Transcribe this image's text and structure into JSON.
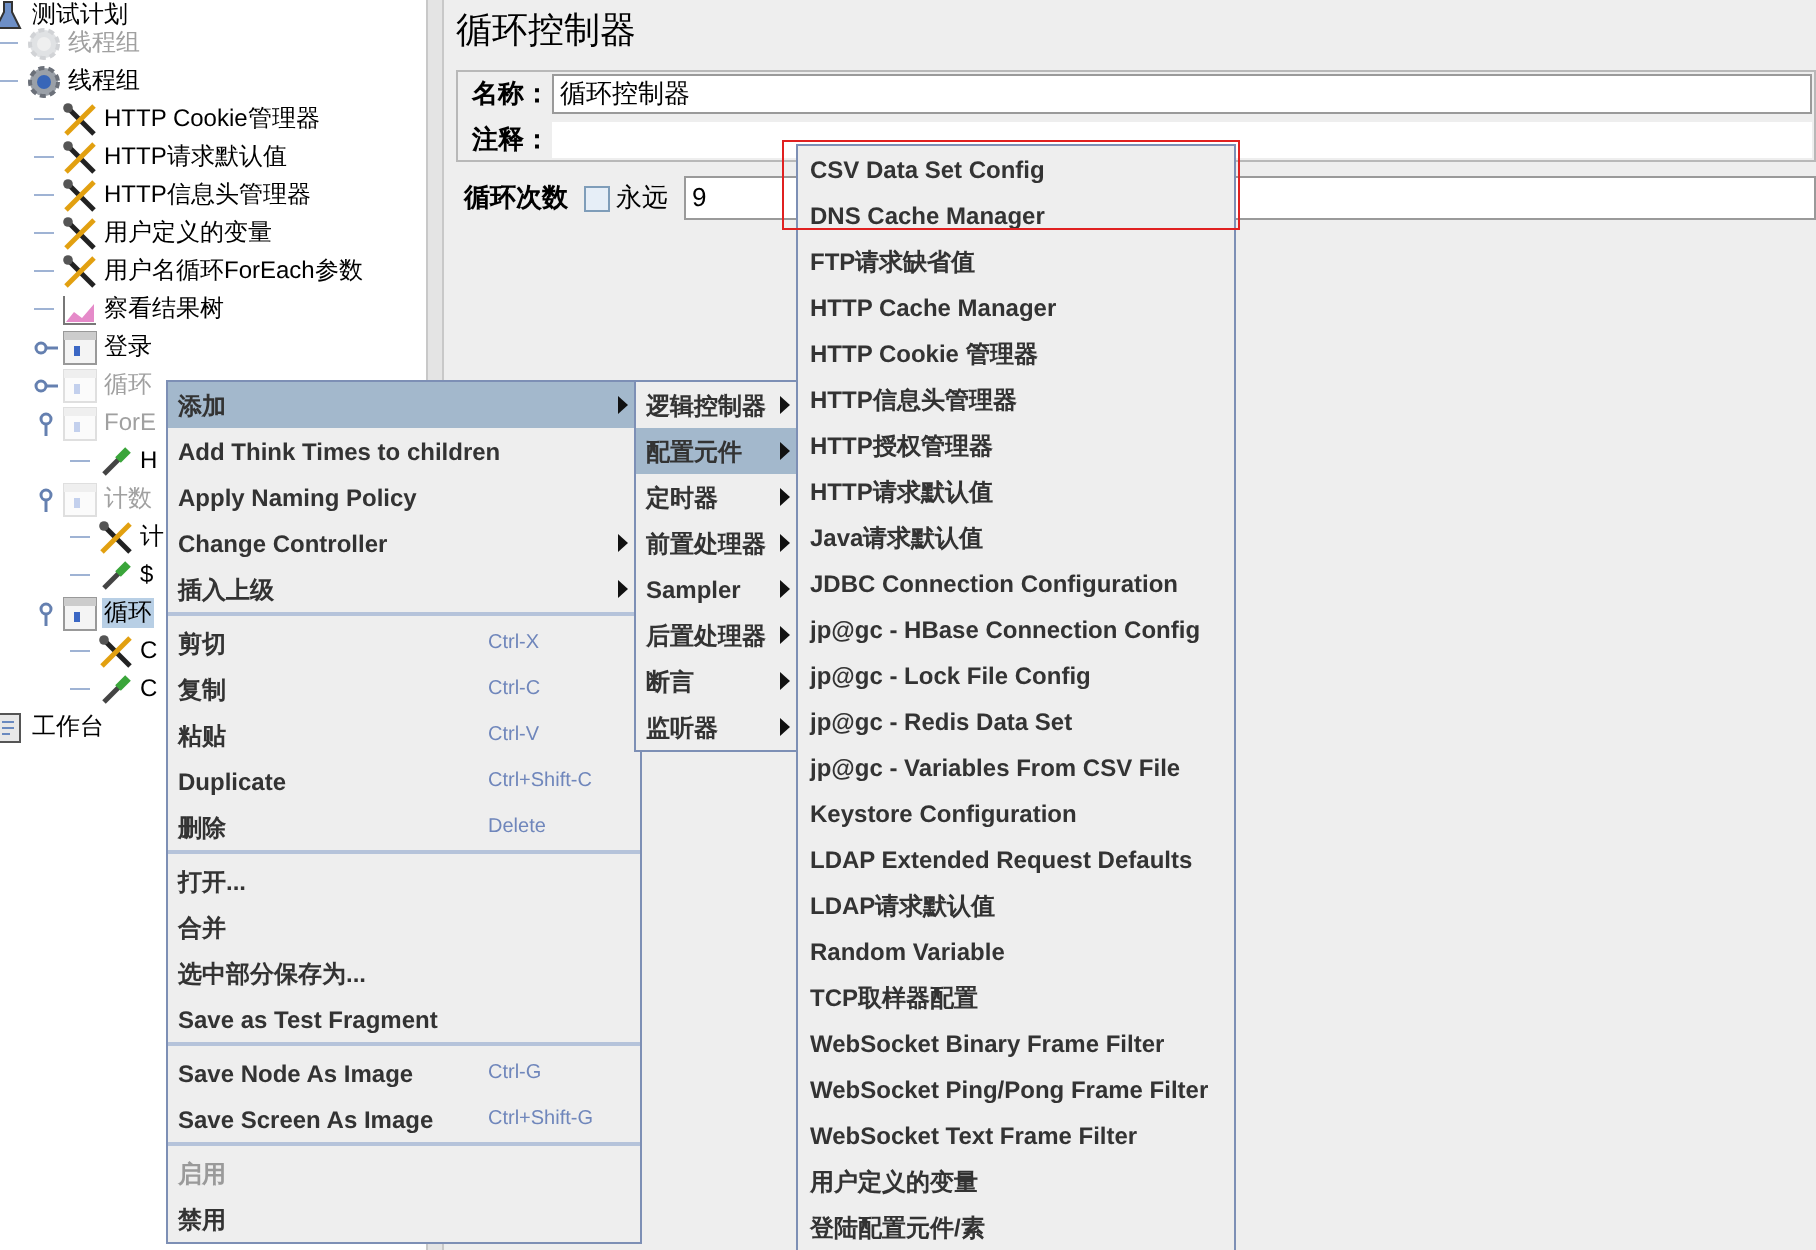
{
  "tree": [
    {
      "label": "测试计划",
      "kind": "plan",
      "selected": false,
      "disabled": false,
      "children": [
        {
          "label": "线程组",
          "kind": "thread",
          "selected": false,
          "disabled": true
        },
        {
          "label": "线程组",
          "kind": "thread",
          "selected": false,
          "disabled": false,
          "children": [
            {
              "label": "HTTP Cookie管理器",
              "kind": "config",
              "selected": false,
              "disabled": false
            },
            {
              "label": "HTTP请求默认值",
              "kind": "config",
              "selected": false,
              "disabled": false
            },
            {
              "label": "HTTP信息头管理器",
              "kind": "config",
              "selected": false,
              "disabled": false
            },
            {
              "label": "用户定义的变量",
              "kind": "config",
              "selected": false,
              "disabled": false
            },
            {
              "label": "用户名循环ForEach参数",
              "kind": "config",
              "selected": false,
              "disabled": false
            },
            {
              "label": "察看结果树",
              "kind": "listener",
              "selected": false,
              "disabled": false
            },
            {
              "label": "登录",
              "kind": "controller",
              "selected": false,
              "disabled": false,
              "expanded": false
            },
            {
              "label": "循环",
              "kind": "controller",
              "selected": false,
              "disabled": true,
              "expanded": false
            },
            {
              "label": "ForE",
              "kind": "controller",
              "selected": false,
              "disabled": true,
              "expanded": true,
              "children": [
                {
                  "label": "H",
                  "kind": "sampler",
                  "selected": false,
                  "disabled": false
                }
              ]
            },
            {
              "label": "计数",
              "kind": "controller",
              "selected": false,
              "disabled": true,
              "expanded": true,
              "children": [
                {
                  "label": "计",
                  "kind": "config",
                  "selected": false,
                  "disabled": false
                },
                {
                  "label": "$",
                  "kind": "sampler",
                  "selected": false,
                  "disabled": false
                }
              ]
            },
            {
              "label": "循环",
              "kind": "controller",
              "selected": true,
              "disabled": false,
              "expanded": true,
              "children": [
                {
                  "label": "C",
                  "kind": "config",
                  "selected": false,
                  "disabled": false
                },
                {
                  "label": "C",
                  "kind": "sampler",
                  "selected": false,
                  "disabled": false
                }
              ]
            }
          ]
        }
      ]
    },
    {
      "label": "工作台",
      "kind": "workbench",
      "selected": false,
      "disabled": false
    }
  ],
  "editor": {
    "title": "循环控制器",
    "name_label": "名称：",
    "name_value": "循环控制器",
    "comment_label": "注释：",
    "loop_label": "循环次数",
    "forever_label": "永远",
    "forever_checked": false,
    "loop_value": "9"
  },
  "context_menu": {
    "groups": [
      [
        {
          "label": "添加",
          "submenu": true,
          "selected": true,
          "disabled": false
        },
        {
          "label": "Add Think Times to children",
          "submenu": false,
          "selected": false,
          "disabled": false
        },
        {
          "label": "Apply Naming Policy",
          "submenu": false,
          "selected": false,
          "disabled": false
        },
        {
          "label": "Change Controller",
          "submenu": true,
          "selected": false,
          "disabled": false
        },
        {
          "label": "插入上级",
          "submenu": true,
          "selected": false,
          "disabled": false
        }
      ],
      [
        {
          "label": "剪切",
          "shortcut": "Ctrl-X",
          "submenu": false,
          "selected": false,
          "disabled": false
        },
        {
          "label": "复制",
          "shortcut": "Ctrl-C",
          "submenu": false,
          "selected": false,
          "disabled": false
        },
        {
          "label": "粘贴",
          "shortcut": "Ctrl-V",
          "submenu": false,
          "selected": false,
          "disabled": false
        },
        {
          "label": "Duplicate",
          "shortcut": "Ctrl+Shift-C",
          "submenu": false,
          "selected": false,
          "disabled": false
        },
        {
          "label": "删除",
          "shortcut": "Delete",
          "submenu": false,
          "selected": false,
          "disabled": false
        }
      ],
      [
        {
          "label": "打开...",
          "submenu": false,
          "selected": false,
          "disabled": false
        },
        {
          "label": "合并",
          "submenu": false,
          "selected": false,
          "disabled": false
        },
        {
          "label": "选中部分保存为...",
          "submenu": false,
          "selected": false,
          "disabled": false
        },
        {
          "label": "Save as Test Fragment",
          "submenu": false,
          "selected": false,
          "disabled": false
        }
      ],
      [
        {
          "label": "Save Node As Image",
          "shortcut": "Ctrl-G",
          "submenu": false,
          "selected": false,
          "disabled": false
        },
        {
          "label": "Save Screen As Image",
          "shortcut": "Ctrl+Shift-G",
          "submenu": false,
          "selected": false,
          "disabled": false
        }
      ],
      [
        {
          "label": "启用",
          "submenu": false,
          "selected": false,
          "disabled": true
        },
        {
          "label": "禁用",
          "submenu": false,
          "selected": false,
          "disabled": false
        }
      ]
    ]
  },
  "add_submenu": [
    {
      "label": "逻辑控制器",
      "selected": false
    },
    {
      "label": "配置元件",
      "selected": true
    },
    {
      "label": "定时器",
      "selected": false
    },
    {
      "label": "前置处理器",
      "selected": false
    },
    {
      "label": "Sampler",
      "selected": false
    },
    {
      "label": "后置处理器",
      "selected": false
    },
    {
      "label": "断言",
      "selected": false
    },
    {
      "label": "监听器",
      "selected": false
    }
  ],
  "config_submenu": [
    {
      "label": "CSV Data Set Config",
      "selected": false
    },
    {
      "label": "DNS Cache Manager",
      "selected": false
    },
    {
      "label": "FTP请求缺省值",
      "selected": false
    },
    {
      "label": "HTTP Cache Manager",
      "selected": false
    },
    {
      "label": "HTTP Cookie 管理器",
      "selected": false
    },
    {
      "label": "HTTP信息头管理器",
      "selected": false
    },
    {
      "label": "HTTP授权管理器",
      "selected": false
    },
    {
      "label": "HTTP请求默认值",
      "selected": false
    },
    {
      "label": "Java请求默认值",
      "selected": false
    },
    {
      "label": "JDBC Connection Configuration",
      "selected": false
    },
    {
      "label": "jp@gc - HBase Connection Config",
      "selected": false
    },
    {
      "label": "jp@gc - Lock File Config",
      "selected": false
    },
    {
      "label": "jp@gc - Redis Data Set",
      "selected": false
    },
    {
      "label": "jp@gc - Variables From CSV File",
      "selected": false
    },
    {
      "label": "Keystore Configuration",
      "selected": false
    },
    {
      "label": "LDAP Extended Request Defaults",
      "selected": false
    },
    {
      "label": "LDAP请求默认值",
      "selected": false
    },
    {
      "label": "Random Variable",
      "selected": false
    },
    {
      "label": "TCP取样器配置",
      "selected": false
    },
    {
      "label": "WebSocket Binary Frame Filter",
      "selected": false
    },
    {
      "label": "WebSocket Ping/Pong Frame Filter",
      "selected": false
    },
    {
      "label": "WebSocket Text Frame Filter",
      "selected": false
    },
    {
      "label": "用户定义的变量",
      "selected": false
    },
    {
      "label": "登陆配置元件/素",
      "selected": false
    }
  ]
}
